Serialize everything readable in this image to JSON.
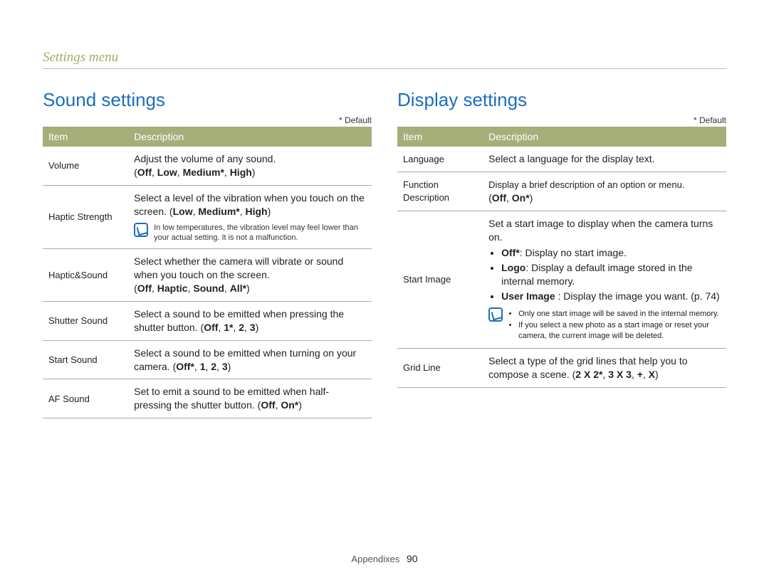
{
  "breadcrumb": "Settings menu",
  "default_label": "* Default",
  "footer_section": "Appendixes",
  "footer_page": "90",
  "left": {
    "heading": "Sound settings",
    "headers": {
      "item": "Item",
      "desc": "Description"
    },
    "rows": {
      "volume": {
        "item": "Volume",
        "desc": "Adjust the volume of any sound.",
        "opts_prefix": "(",
        "opts": [
          "Off",
          "Low",
          "Medium*",
          "High"
        ],
        "opts_suffix": ")"
      },
      "haptic_strength": {
        "item": "Haptic Strength",
        "desc": "Select a level of the vibration when you touch on the screen. ",
        "opts_prefix": "(",
        "opts": [
          "Low",
          "Medium*",
          "High"
        ],
        "opts_suffix": ")",
        "note": "In low temperatures, the vibration level may feel lower than your actual setting. It is not a malfunction."
      },
      "haptic_sound": {
        "item": "Haptic&Sound",
        "desc": "Select whether the camera will vibrate or sound when you touch on the screen.",
        "opts_prefix": "(",
        "opts": [
          "Off",
          "Haptic",
          "Sound",
          "All*"
        ],
        "opts_suffix": ")"
      },
      "shutter_sound": {
        "item": "Shutter Sound",
        "desc": "Select a sound to be emitted when pressing the shutter button. ",
        "opts_prefix": "(",
        "opts": [
          "Off",
          "1*",
          "2",
          "3"
        ],
        "opts_suffix": ")"
      },
      "start_sound": {
        "item": "Start Sound",
        "desc": "Select a sound to be emitted when turning on your camera. ",
        "opts_prefix": "(",
        "opts": [
          "Off*",
          "1",
          "2",
          "3"
        ],
        "opts_suffix": ")"
      },
      "af_sound": {
        "item": "AF Sound",
        "desc": "Set to emit a sound to be emitted when half-pressing the shutter button. ",
        "opts_prefix": "(",
        "opts": [
          "Off",
          "On*"
        ],
        "opts_suffix": ")"
      }
    }
  },
  "right": {
    "heading": "Display settings",
    "headers": {
      "item": "Item",
      "desc": "Description"
    },
    "rows": {
      "language": {
        "item": "Language",
        "desc": "Select a language for the display text."
      },
      "function_description": {
        "item": "Function Description",
        "desc": "Display a brief description of an option or menu.",
        "opts_prefix": "(",
        "opts": [
          "Off",
          "On*"
        ],
        "opts_suffix": ")"
      },
      "start_image": {
        "item": "Start Image",
        "intro": "Set a start image to display when the camera turns on.",
        "bullets": {
          "off": {
            "label": "Off*",
            "text": ": Display no start image."
          },
          "logo": {
            "label": "Logo",
            "text": ": Display a default image stored in the internal memory."
          },
          "user": {
            "label": "User Image",
            "text": " : Display the image you want. (p. 74)"
          }
        },
        "notes": [
          "Only one start image will be saved in the internal memory.",
          "If you select a new photo as a start image or reset your camera, the current image will be deleted."
        ]
      },
      "grid_line": {
        "item": "Grid Line",
        "desc": "Select a type of the grid lines that help you to compose a scene. ",
        "opts_prefix": "(",
        "opts": [
          "2 X 2*",
          "3 X 3",
          "+",
          "X"
        ],
        "opts_suffix": ")"
      }
    }
  }
}
